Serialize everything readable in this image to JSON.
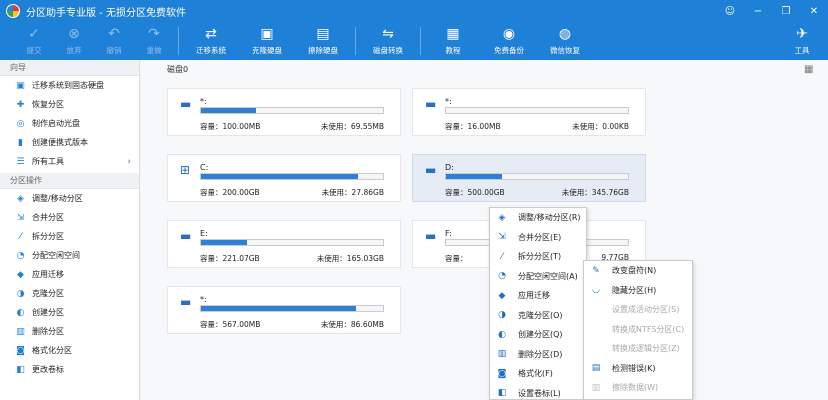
{
  "window": {
    "title": "分区助手专业版 - 无损分区免费软件",
    "controls": [
      "☺",
      "−",
      "❐",
      "✕"
    ]
  },
  "toolbar": {
    "left": [
      {
        "label": "提交",
        "icon": "check-icon",
        "glyph": "✓",
        "enabled": false
      },
      {
        "label": "放弃",
        "icon": "cancel-icon",
        "glyph": "⊗",
        "enabled": false
      },
      {
        "label": "撤销",
        "icon": "undo-icon",
        "glyph": "↶",
        "enabled": false
      },
      {
        "label": "重做",
        "icon": "redo-icon",
        "glyph": "↷",
        "enabled": false
      }
    ],
    "middle1": [
      {
        "label": "迁移系统",
        "icon": "migrate-os-icon",
        "glyph": "⇄"
      },
      {
        "label": "克隆硬盘",
        "icon": "clone-disk-icon",
        "glyph": "▣"
      },
      {
        "label": "擦除硬盘",
        "icon": "wipe-disk-icon",
        "glyph": "▤"
      }
    ],
    "middle2": [
      {
        "label": "磁盘转换",
        "icon": "disk-convert-icon",
        "glyph": "⇋"
      }
    ],
    "middle3": [
      {
        "label": "教程",
        "icon": "tutorial-icon",
        "glyph": "▦"
      },
      {
        "label": "免费备份",
        "icon": "backup-icon",
        "glyph": "◉"
      },
      {
        "label": "微信恢复",
        "icon": "wechat-recover-icon",
        "glyph": "◍"
      }
    ],
    "right": [
      {
        "label": "工具",
        "icon": "tools-icon",
        "glyph": "✈"
      }
    ]
  },
  "sidebar": {
    "guide_title": "向导",
    "guide_items": [
      {
        "label": "迁移系统到固态硬盘",
        "icon": "migrate-ssd-icon",
        "glyph": "▣"
      },
      {
        "label": "恢复分区",
        "icon": "recover-partition-icon",
        "glyph": "✚"
      },
      {
        "label": "制作启动光盘",
        "icon": "boot-disc-icon",
        "glyph": "◎"
      },
      {
        "label": "创建便携式版本",
        "icon": "portable-icon",
        "glyph": "▮"
      },
      {
        "label": "所有工具",
        "icon": "all-tools-icon",
        "glyph": "☰"
      }
    ],
    "ops_title": "分区操作",
    "ops_items": [
      {
        "label": "调整/移动分区",
        "icon": "resize-icon",
        "glyph": "◈"
      },
      {
        "label": "合并分区",
        "icon": "merge-icon",
        "glyph": "⇲"
      },
      {
        "label": "拆分分区",
        "icon": "split-icon",
        "glyph": "⁄"
      },
      {
        "label": "分配空闲空间",
        "icon": "allocate-icon",
        "glyph": "◔"
      },
      {
        "label": "应用迁移",
        "icon": "app-move-icon",
        "glyph": "◆"
      },
      {
        "label": "克隆分区",
        "icon": "clone-partition-icon",
        "glyph": "◑"
      },
      {
        "label": "创建分区",
        "icon": "create-partition-icon",
        "glyph": "◐"
      },
      {
        "label": "删除分区",
        "icon": "delete-partition-icon",
        "glyph": "▥"
      },
      {
        "label": "格式化分区",
        "icon": "format-icon",
        "glyph": "◙"
      },
      {
        "label": "更改卷标",
        "icon": "label-icon",
        "glyph": "◧"
      }
    ]
  },
  "main": {
    "disk_label": "磁盘0",
    "partitions": [
      {
        "name": "*:",
        "capacity": "容量：100.00MB",
        "free": "未使用：69.55MB",
        "used_fraction": 0.3,
        "icon": "drive-icon"
      },
      {
        "name": "*:",
        "capacity": "容量：16.00MB",
        "free": "未使用：0.00KB",
        "used_fraction": 0.0,
        "icon": "drive-icon"
      },
      {
        "name": "C:",
        "capacity": "容量：200.00GB",
        "free": "未使用：27.86GB",
        "used_fraction": 0.86,
        "icon": "windows-drive-icon"
      },
      {
        "name": "D:",
        "capacity": "容量：500.00GB",
        "free": "未使用：345.76GB",
        "used_fraction": 0.31,
        "icon": "drive-icon"
      },
      {
        "name": "E:",
        "capacity": "容量：221.07GB",
        "free": "未使用：165.03GB",
        "used_fraction": 0.25,
        "icon": "drive-icon"
      },
      {
        "name": "F:",
        "capacity": "容量：",
        "free": "9.77GB",
        "used_fraction": 0.0,
        "icon": "drive-icon"
      },
      {
        "name": "*:",
        "capacity": "容量：567.00MB",
        "free": "未使用：86.60MB",
        "used_fraction": 0.85,
        "icon": "drive-icon"
      }
    ]
  },
  "context_menu": {
    "items": [
      {
        "label": "调整/移动分区(R)",
        "icon": "resize-icon",
        "glyph": "◈"
      },
      {
        "label": "合并分区(E)",
        "icon": "merge-icon",
        "glyph": "⇲"
      },
      {
        "label": "拆分分区(T)",
        "icon": "split-icon",
        "glyph": "⁄"
      },
      {
        "label": "分配空闲空间(A)",
        "icon": "allocate-icon",
        "glyph": "◔"
      },
      {
        "label": "应用迁移",
        "icon": "app-move-icon",
        "glyph": "◆"
      },
      {
        "label": "克隆分区(O)",
        "icon": "clone-partition-icon",
        "glyph": "◑"
      },
      {
        "label": "创建分区(Q)",
        "icon": "create-partition-icon",
        "glyph": "◐"
      },
      {
        "label": "删除分区(D)",
        "icon": "delete-partition-icon",
        "glyph": "▥"
      },
      {
        "label": "格式化(F)",
        "icon": "format-icon",
        "glyph": "◙"
      },
      {
        "label": "设置卷标(L)",
        "icon": "label-icon",
        "glyph": "◧"
      }
    ],
    "advanced_arrow": "›"
  },
  "submenu": {
    "items": [
      {
        "label": "改变盘符(N)",
        "icon": "pencil-icon",
        "glyph": "✎",
        "enabled": true
      },
      {
        "label": "隐藏分区(H)",
        "icon": "hide-icon",
        "glyph": "◡",
        "enabled": true
      },
      {
        "label": "设置成活动分区(S)",
        "icon": "",
        "glyph": "",
        "enabled": false
      },
      {
        "label": "转换成NTFS分区(C)",
        "icon": "",
        "glyph": "",
        "enabled": false
      },
      {
        "label": "转换成逻辑分区(Z)",
        "icon": "",
        "glyph": "",
        "enabled": false
      },
      {
        "label": "检测错误(K)",
        "icon": "check-disk-icon",
        "glyph": "▤",
        "enabled": true
      },
      {
        "label": "擦除数据(W)",
        "icon": "wipe-data-icon",
        "glyph": "▥",
        "enabled": false
      }
    ]
  },
  "colors": {
    "titlebar": "#1f80d8",
    "bar_fill": "#2f7fd6",
    "selected_card": "#e6ecf5"
  }
}
